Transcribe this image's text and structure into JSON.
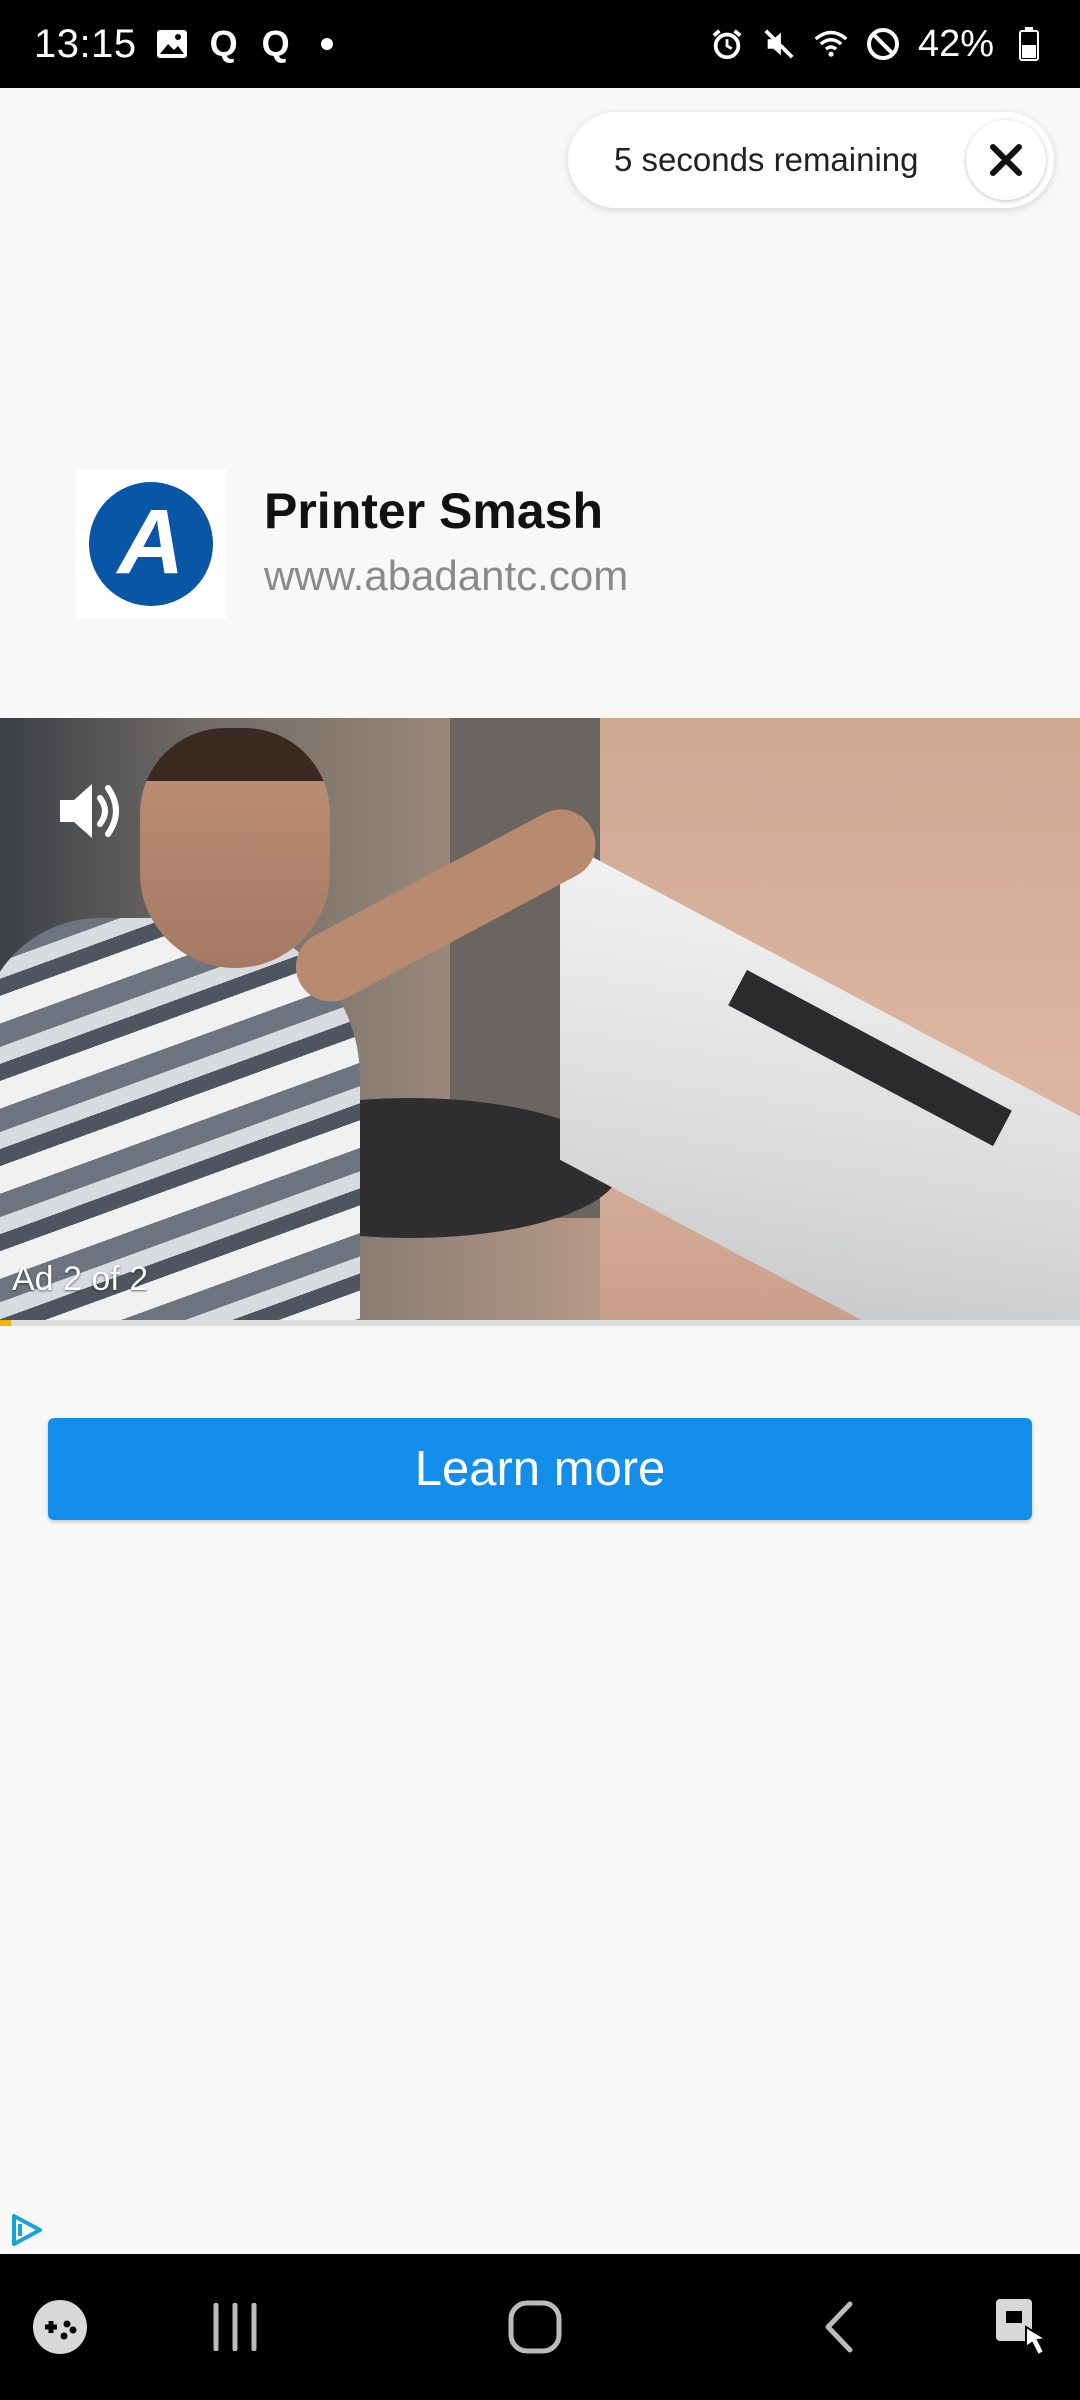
{
  "status_bar": {
    "time": "13:15",
    "notification_icons": [
      "image-icon",
      "q-app-icon",
      "q-app-icon",
      "dot"
    ],
    "q_glyph": "Q",
    "system_icons": [
      "alarm-icon",
      "mute-icon",
      "wifi-icon",
      "dnd-icon",
      "battery-icon"
    ],
    "battery": "42%"
  },
  "countdown": {
    "text": "5 seconds remaining",
    "close_icon": "close-icon"
  },
  "advertiser": {
    "logo_icon": "advertiser-logo-icon",
    "logo_letter": "A",
    "title": "Printer Smash",
    "url": "www.abadantc.com"
  },
  "video": {
    "volume_icon": "volume-icon",
    "ad_counter": "Ad 2 of 2",
    "progress": 0.01
  },
  "cta": {
    "label": "Learn more",
    "color": "#138eea"
  },
  "adchoices_icon": "adchoices-icon",
  "nav_bar": {
    "items": [
      "game-launcher-icon",
      "recents-icon",
      "home-icon",
      "back-icon",
      "accessibility-icon"
    ]
  }
}
